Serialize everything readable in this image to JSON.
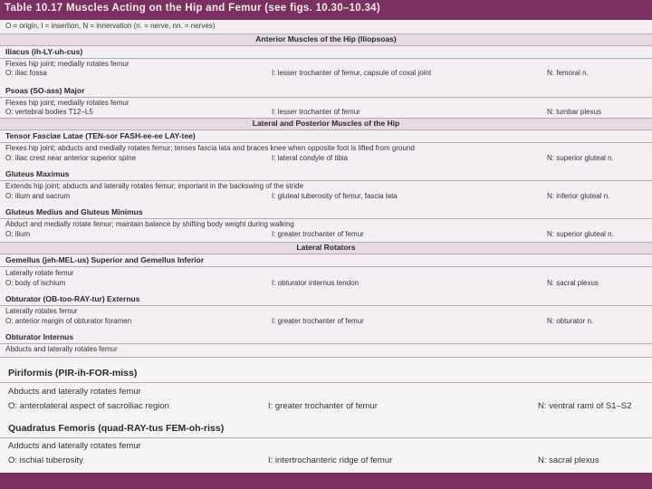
{
  "title": "Table 10.17 Muscles Acting on the Hip and Femur (see figs. 10.30–10.34)",
  "legend": "O = origin, I = insertion, N = innervation (n. = nerve, nn. = nerves)",
  "sections": [
    "Anterior Muscles of the Hip (Iliopsoas)",
    "Lateral and Posterior Muscles of the Hip",
    "Lateral Rotators"
  ],
  "rows": [
    {
      "name": "Iliacus (ih-LY-uh-cus)",
      "action": "Flexes hip joint; medially rotates femur",
      "origin": "O: iliac fossa",
      "insertion": "I: lesser trochanter of femur, capsule of coxal joint",
      "nerve": "N: femoral n."
    },
    {
      "name": "Psoas (SO-ass) Major",
      "action": "Flexes hip joint; medially rotates femur",
      "origin": "O: vertebral bodies T12–L5",
      "insertion": "I: lesser trochanter of femur",
      "nerve": "N: lumbar plexus"
    },
    {
      "name": "Tensor Fasciae Latae (TEN-sor FASH-ee-ee LAY-tee)",
      "action": "Flexes hip joint; abducts and medially rotates femur; tenses fascia lata and braces knee when opposite foot is lifted from ground",
      "origin": "O: iliac crest near anterior superior spine",
      "insertion": "I: lateral condyle of tibia",
      "nerve": "N: superior gluteal n."
    },
    {
      "name": "Gluteus Maximus",
      "action": "Extends hip joint; abducts and laterally rotates femur; important in the backswing of the stride",
      "origin": "O: ilium and sacrum",
      "insertion": "I: gluteal tuberosity of femur, fascia lata",
      "nerve": "N: inferior gluteal n."
    },
    {
      "name": "Gluteus Medius and Gluteus Minimus",
      "action": "Abduct and medially rotate femur; maintain balance by shifting body weight during walking",
      "origin": "O: ilium",
      "insertion": "I: greater trochanter of femur",
      "nerve": "N: superior gluteal n."
    },
    {
      "name": "Gemellus (jeh-MEL-us) Superior and Gemellus Inferior",
      "action": "Laterally rotate femur",
      "origin": "O: body of ischium",
      "insertion": "I: obturator internus tendon",
      "nerve": "N: sacral plexus"
    },
    {
      "name": "Obturator (OB-too-RAY-tur) Externus",
      "action": "Laterally rotates femur",
      "origin": "O: anterior margin of obturator foramen",
      "insertion": "I: greater trochanter of femur",
      "nerve": "N: obturator n."
    },
    {
      "name": "Obturator Internus",
      "action": "Abducts and laterally rotates femur"
    },
    {
      "name": "Piriformis (PIR-ih-FOR-miss)",
      "action": "Abducts and laterally rotates femur",
      "origin": "O: anterolateral aspect of sacroiliac region",
      "insertion": "I: greater trochanter of femur",
      "nerve": "N: ventral rami of S1–S2"
    },
    {
      "name": "Quadratus Femoris (quad-RAY-tus FEM-oh-riss)",
      "action": "Adducts and laterally rotates femur",
      "origin": "O: ischial tuberosity",
      "insertion": "I: intertrochanteric ridge of femur",
      "nerve": "N: sacral plexus"
    }
  ],
  "colors": {
    "bar": "#7a3060",
    "band": "#e6dbe2",
    "paper": "#f3eff2"
  }
}
